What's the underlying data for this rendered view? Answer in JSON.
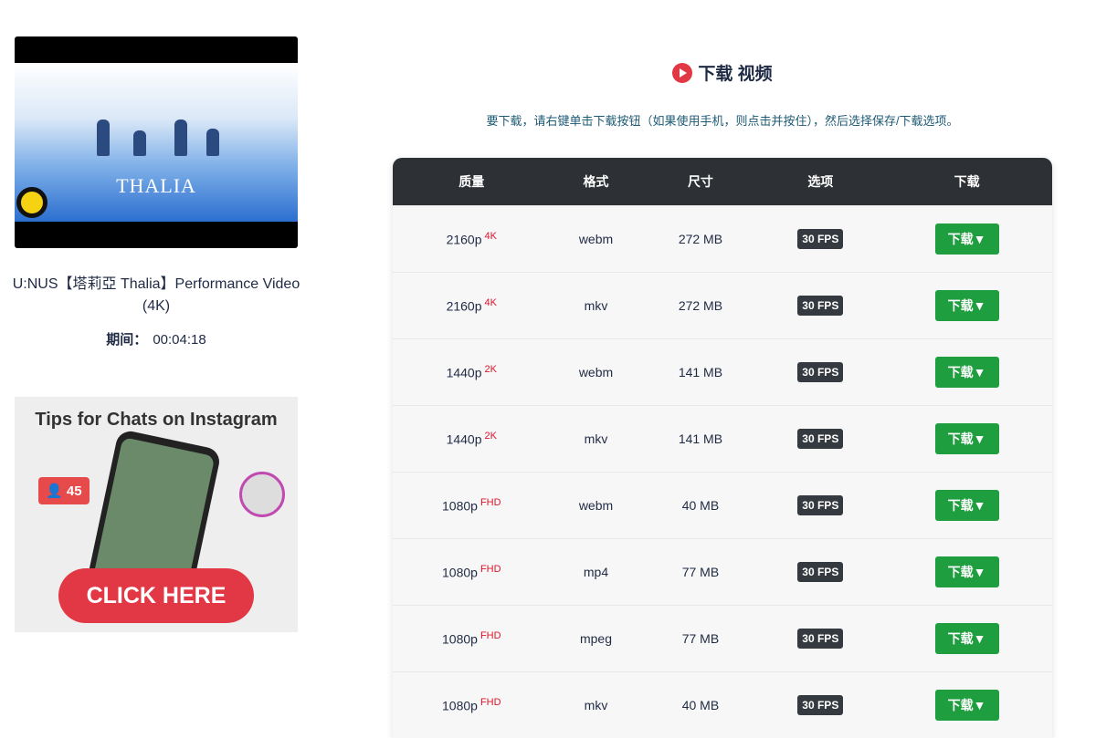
{
  "video": {
    "thumbnail_text": "THALIA",
    "title": "U:NUS【塔莉亞 Thalia】Performance Video (4K)",
    "duration_label": "期间：",
    "duration": "00:04:18"
  },
  "ad": {
    "heading": "Tips for Chats on Instagram",
    "count": "45",
    "cta": "CLICK HERE"
  },
  "main": {
    "title": "下载 视频",
    "hint": "要下载，请右键单击下载按钮（如果使用手机，则点击并按住），然后选择保存/下载选项。",
    "columns": [
      "质量",
      "格式",
      "尺寸",
      "选项",
      "下载"
    ],
    "rows": [
      {
        "quality": "2160p",
        "tag": "4K",
        "format": "webm",
        "size": "272 MB",
        "fps": "30 FPS",
        "button": "下载▼"
      },
      {
        "quality": "2160p",
        "tag": "4K",
        "format": "mkv",
        "size": "272 MB",
        "fps": "30 FPS",
        "button": "下载▼"
      },
      {
        "quality": "1440p",
        "tag": "2K",
        "format": "webm",
        "size": "141 MB",
        "fps": "30 FPS",
        "button": "下载▼"
      },
      {
        "quality": "1440p",
        "tag": "2K",
        "format": "mkv",
        "size": "141 MB",
        "fps": "30 FPS",
        "button": "下载▼"
      },
      {
        "quality": "1080p",
        "tag": "FHD",
        "format": "webm",
        "size": "40 MB",
        "fps": "30 FPS",
        "button": "下载▼"
      },
      {
        "quality": "1080p",
        "tag": "FHD",
        "format": "mp4",
        "size": "77 MB",
        "fps": "30 FPS",
        "button": "下载▼"
      },
      {
        "quality": "1080p",
        "tag": "FHD",
        "format": "mpeg",
        "size": "77 MB",
        "fps": "30 FPS",
        "button": "下载▼"
      },
      {
        "quality": "1080p",
        "tag": "FHD",
        "format": "mkv",
        "size": "40 MB",
        "fps": "30 FPS",
        "button": "下载▼"
      }
    ]
  },
  "colors": {
    "accent": "#e23744",
    "button": "#1e9e3e",
    "header": "#2d3035",
    "tag": "#e0142b"
  }
}
